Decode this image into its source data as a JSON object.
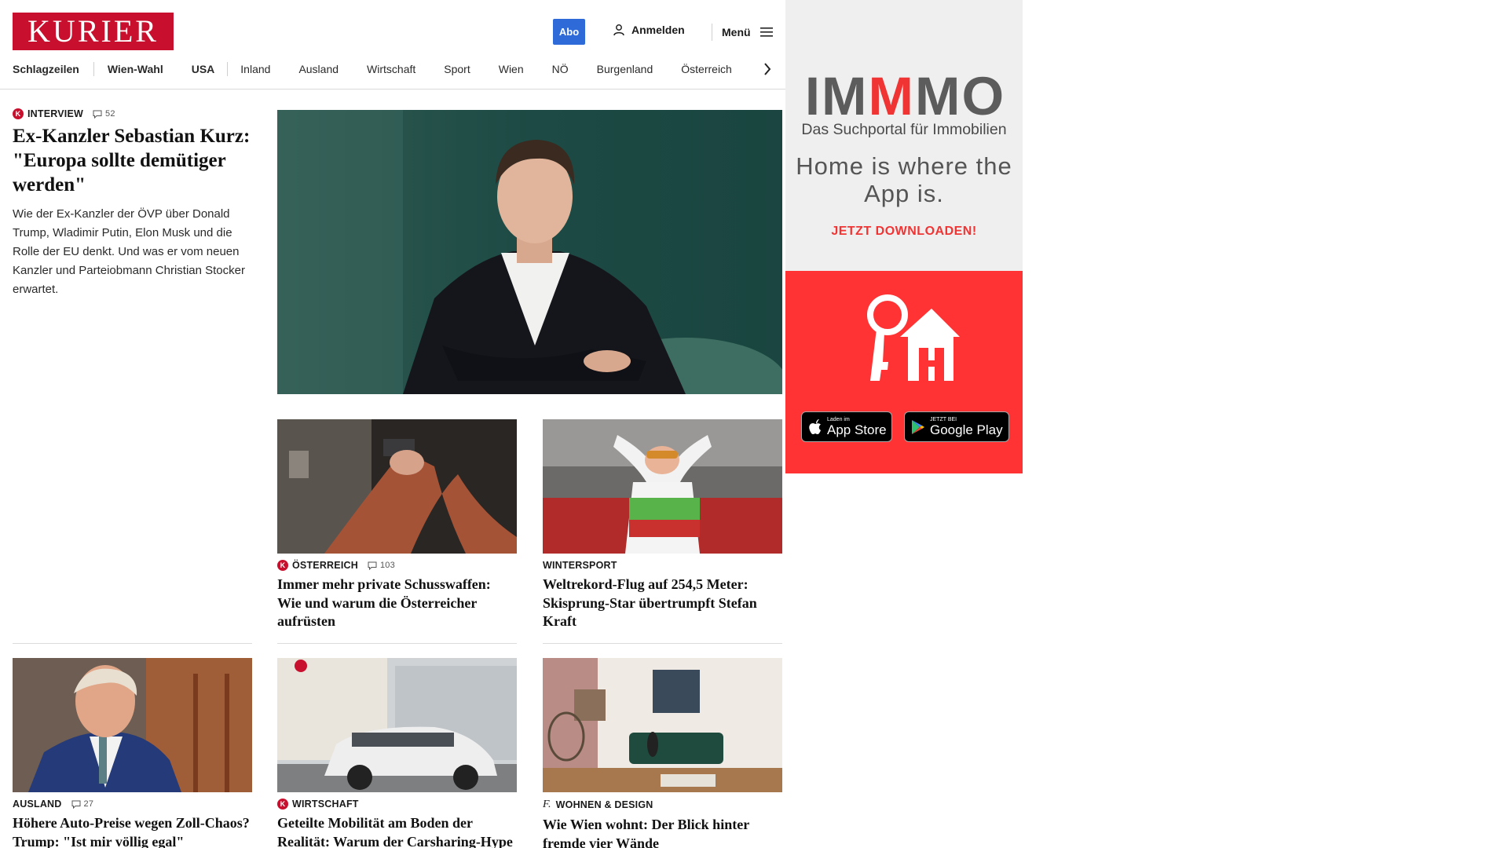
{
  "header": {
    "logo_text": "KURIER",
    "abo_label": "Abo",
    "login_label": "Anmelden",
    "menu_label": "Menü",
    "nav": [
      "Schlagzeilen",
      "Wien-Wahl",
      "USA",
      "Inland",
      "Ausland",
      "Wirtschaft",
      "Sport",
      "Wien",
      "NÖ",
      "Burgenland",
      "Österreich"
    ]
  },
  "lead": {
    "kicker": "INTERVIEW",
    "comments": "52",
    "headline": "Ex-Kanzler Sebastian Kurz: \"Europa sollte demütiger werden\"",
    "teaser": "Wie der Ex-Kanzler der ÖVP über Donald Trump, Wladimir Putin, Elon Musk und die Rolle der EU denkt. Und was er vom neuen Kanzler und Parteiobmann Christian Stocker erwartet."
  },
  "articles": [
    {
      "kicker": "ÖSTERREICH",
      "comments": "103",
      "headline": "Immer mehr private Schusswaffen: Wie und warum die Österreicher aufrüsten"
    },
    {
      "kicker": "WINTERSPORT",
      "headline": "Weltrekord-Flug auf 254,5 Meter: Skisprung-Star übertrumpft Stefan Kraft"
    },
    {
      "kicker": "AUSLAND",
      "comments": "27",
      "headline": "Höhere Auto-Preise wegen Zoll-Chaos? Trump: \"Ist mir völlig egal\""
    },
    {
      "kicker": "WIRTSCHAFT",
      "headline": "Geteilte Mobilität am Boden der Realität: Warum der Carsharing-Hype vorbei ist"
    },
    {
      "kicker": "WOHNEN & DESIGN",
      "headline": "Wie Wien wohnt: Der Blick hinter fremde vier Wände"
    }
  ],
  "ad": {
    "logo_part1": "IM",
    "logo_part2": "M",
    "logo_part3": "MO",
    "tagline": "Das Suchportal für Immobilien",
    "slogan": "Home is where the App is.",
    "cta": "JETZT DOWNLOADEN!",
    "appstore_small": "Laden im",
    "appstore_big": "App Store",
    "googleplay_small": "JETZT BEI",
    "googleplay_big": "Google Play"
  },
  "colors": {
    "brand_red": "#c8102e",
    "abo_blue": "#2e6bd8",
    "immo_red": "#f03434"
  }
}
